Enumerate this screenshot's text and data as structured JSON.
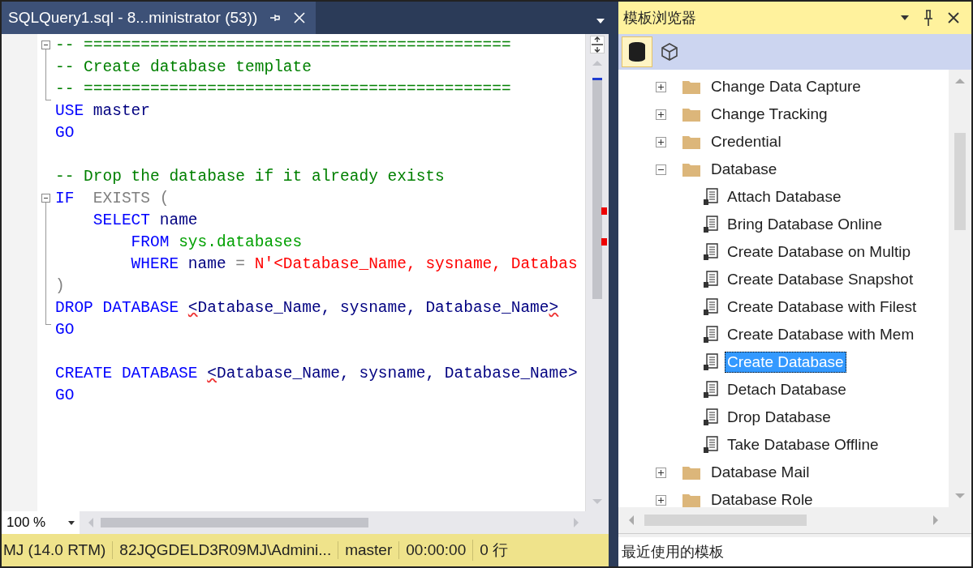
{
  "editor": {
    "tab_title": "SQLQuery1.sql - 8...ministrator (53))",
    "lines": [
      {
        "fold": true,
        "tokens": [
          {
            "kind": "comment",
            "text": "-- ============================================="
          }
        ]
      },
      {
        "fold": false,
        "tokens": [
          {
            "kind": "comment",
            "text": "-- Create database template"
          }
        ]
      },
      {
        "fold": false,
        "tokens": [
          {
            "kind": "comment",
            "text": "-- ============================================="
          }
        ]
      },
      {
        "fold": false,
        "tokens": [
          {
            "kind": "keyword",
            "text": "USE"
          },
          {
            "kind": "plain",
            "text": " master"
          }
        ]
      },
      {
        "fold": false,
        "tokens": [
          {
            "kind": "keyword",
            "text": "GO"
          }
        ]
      },
      {
        "fold": false
      },
      {
        "fold": false,
        "tokens": [
          {
            "kind": "comment",
            "text": "-- Drop the database if it already exists"
          }
        ]
      },
      {
        "fold": true,
        "tokens": [
          {
            "kind": "keyword",
            "text": "IF"
          },
          {
            "kind": "operator",
            "text": "  EXISTS ("
          }
        ]
      },
      {
        "fold": false,
        "tokens": [
          {
            "kind": "keyword",
            "text": "    SELECT"
          },
          {
            "kind": "plain",
            "text": " name"
          }
        ]
      },
      {
        "fold": false,
        "tokens": [
          {
            "kind": "keyword",
            "text": "        FROM"
          },
          {
            "kind": "system",
            "text": " sys.databases"
          }
        ]
      },
      {
        "fold": false,
        "tokens": [
          {
            "kind": "keyword",
            "text": "        WHERE"
          },
          {
            "kind": "plain",
            "text": " name"
          },
          {
            "kind": "operator",
            "text": " ="
          },
          {
            "kind": "string",
            "text": " N'<Database_Name, sysname, Databas"
          }
        ]
      },
      {
        "fold": false,
        "tokens": [
          {
            "kind": "operator",
            "text": ")"
          }
        ]
      },
      {
        "fold": false,
        "tokens": [
          {
            "kind": "keyword",
            "text": "DROP DATABASE "
          },
          {
            "kind": "squiggle",
            "text": "<"
          },
          {
            "kind": "plain",
            "text": "Database_Name, sysname, Database_Name"
          },
          {
            "kind": "squiggle",
            "text": ">"
          }
        ]
      },
      {
        "fold": false,
        "tokens": [
          {
            "kind": "keyword",
            "text": "GO"
          }
        ]
      },
      {
        "fold": false
      },
      {
        "fold": false,
        "tokens": [
          {
            "kind": "keyword",
            "text": "CREATE DATABASE "
          },
          {
            "kind": "squiggle",
            "text": "<"
          },
          {
            "kind": "plain",
            "text": "Database_Name, sysname, Database_Name>"
          }
        ]
      },
      {
        "fold": false,
        "tokens": [
          {
            "kind": "keyword",
            "text": "GO"
          }
        ]
      }
    ],
    "zoom": "100 %"
  },
  "status_bar": [
    "MJ (14.0 RTM)",
    "82JQGDELD3R09MJ\\Admini...",
    "master",
    "00:00:00",
    "0 行"
  ],
  "template_browser": {
    "title": "模板浏览器",
    "toolbar": [
      {
        "kind": "database",
        "selected": true
      },
      {
        "kind": "cube",
        "selected": false
      }
    ],
    "tree": [
      {
        "label": "Change Data Capture",
        "expanded": false,
        "selected": false
      },
      {
        "label": "Change Tracking",
        "expanded": false,
        "selected": false
      },
      {
        "label": "Credential",
        "expanded": false,
        "selected": false
      },
      {
        "label": "Database",
        "expanded": true,
        "selected": false,
        "children": [
          {
            "label": "Attach Database",
            "selected": false
          },
          {
            "label": "Bring Database Online",
            "selected": false
          },
          {
            "label": "Create Database on Multip",
            "selected": false
          },
          {
            "label": "Create Database Snapshot",
            "selected": false
          },
          {
            "label": "Create Database with Filest",
            "selected": false
          },
          {
            "label": "Create Database with Mem",
            "selected": false
          },
          {
            "label": "Create Database",
            "selected": true
          },
          {
            "label": "Detach Database",
            "selected": false
          },
          {
            "label": "Drop Database",
            "selected": false
          },
          {
            "label": "Take Database Offline",
            "selected": false
          }
        ]
      },
      {
        "label": "Database Mail",
        "expanded": false,
        "selected": false
      },
      {
        "label": "Database Role",
        "expanded": false,
        "selected": false
      }
    ],
    "recent_label": "最近使用的模板"
  }
}
